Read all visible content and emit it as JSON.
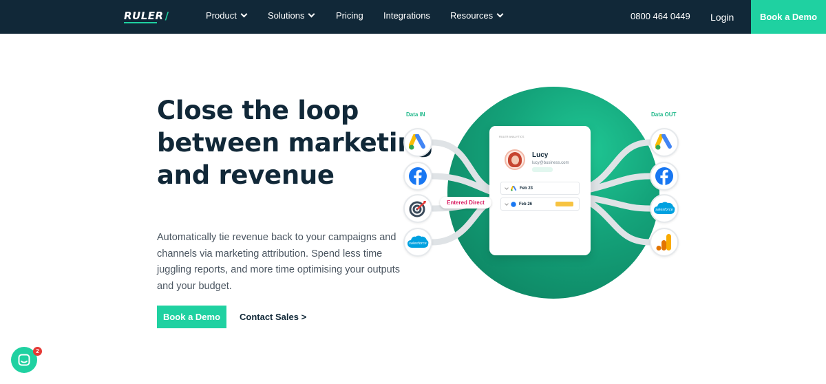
{
  "nav": {
    "logo": "RULER",
    "items": [
      {
        "label": "Product",
        "dropdown": true
      },
      {
        "label": "Solutions",
        "dropdown": true
      },
      {
        "label": "Pricing",
        "dropdown": false
      },
      {
        "label": "Integrations",
        "dropdown": false
      },
      {
        "label": "Resources",
        "dropdown": true
      }
    ],
    "phone": "0800 464 0449",
    "login": "Login",
    "cta": "Book a Demo"
  },
  "hero": {
    "title_lines": [
      "Close the loop",
      "between marketing",
      "and revenue"
    ],
    "description": "Automatically tie revenue back to your campaigns and channels via marketing attribution. Spend less time juggling reports, and more time optimising your outputs and your budget.",
    "primary_cta": "Book a Demo",
    "secondary_cta": "Contact Sales >"
  },
  "diagram": {
    "data_in_label": "Data IN",
    "data_out_label": "Data OUT",
    "inputs": [
      "google-ads-icon",
      "facebook-icon",
      "target-icon",
      "salesforce-icon"
    ],
    "outputs": [
      "google-ads-icon",
      "facebook-icon",
      "salesforce-icon",
      "google-analytics-icon"
    ],
    "pill": "Entered Direct",
    "card": {
      "header": "RULER ANALYTICS",
      "name": "Lucy",
      "email": "lucy@business.com",
      "rows": [
        {
          "icon": "google-ads-icon",
          "date": "Feb 23"
        },
        {
          "icon": "facebook-icon",
          "date": "Feb 26"
        }
      ]
    },
    "colors": {
      "brand": "#1fd1a1",
      "navy": "#112838",
      "pill_text": "#d81b60"
    }
  },
  "chat": {
    "unread": "2"
  }
}
